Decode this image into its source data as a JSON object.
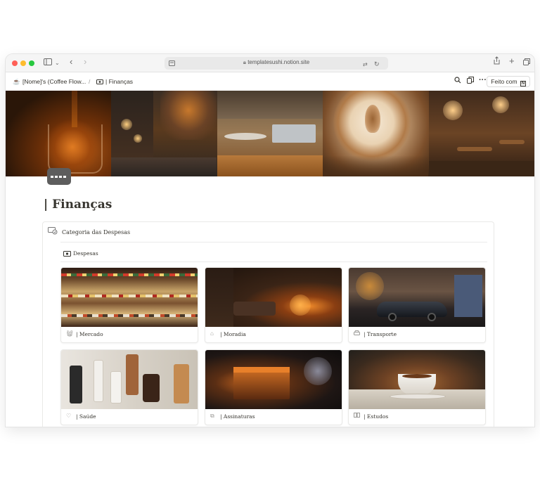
{
  "browser": {
    "url": "templatesushi.notion.site"
  },
  "topbar": {
    "crumb_1": "[Nome]'s (Coffee Flow...",
    "separator": "/",
    "crumb_2": "| Finanças",
    "feito_label": "Feito com"
  },
  "page": {
    "title": "| Finanças"
  },
  "database": {
    "header": "Categoria das Despesas",
    "view_label": "Despesas",
    "cards": [
      {
        "label": "| Mercado",
        "icon": "basket-icon"
      },
      {
        "label": "| Moradia",
        "icon": "home-icon"
      },
      {
        "label": "| Transporte",
        "icon": "car-icon"
      },
      {
        "label": "| Saúde",
        "icon": "heart-icon"
      },
      {
        "label": "| Assinaturas",
        "icon": "subscription-icon"
      },
      {
        "label": "| Estudos",
        "icon": "book-icon"
      }
    ]
  },
  "colors": {
    "text": "#37352f",
    "muted": "#9b9a97",
    "traffic_red": "#ff5f57",
    "traffic_yellow": "#febc2e",
    "traffic_green": "#28c840"
  }
}
